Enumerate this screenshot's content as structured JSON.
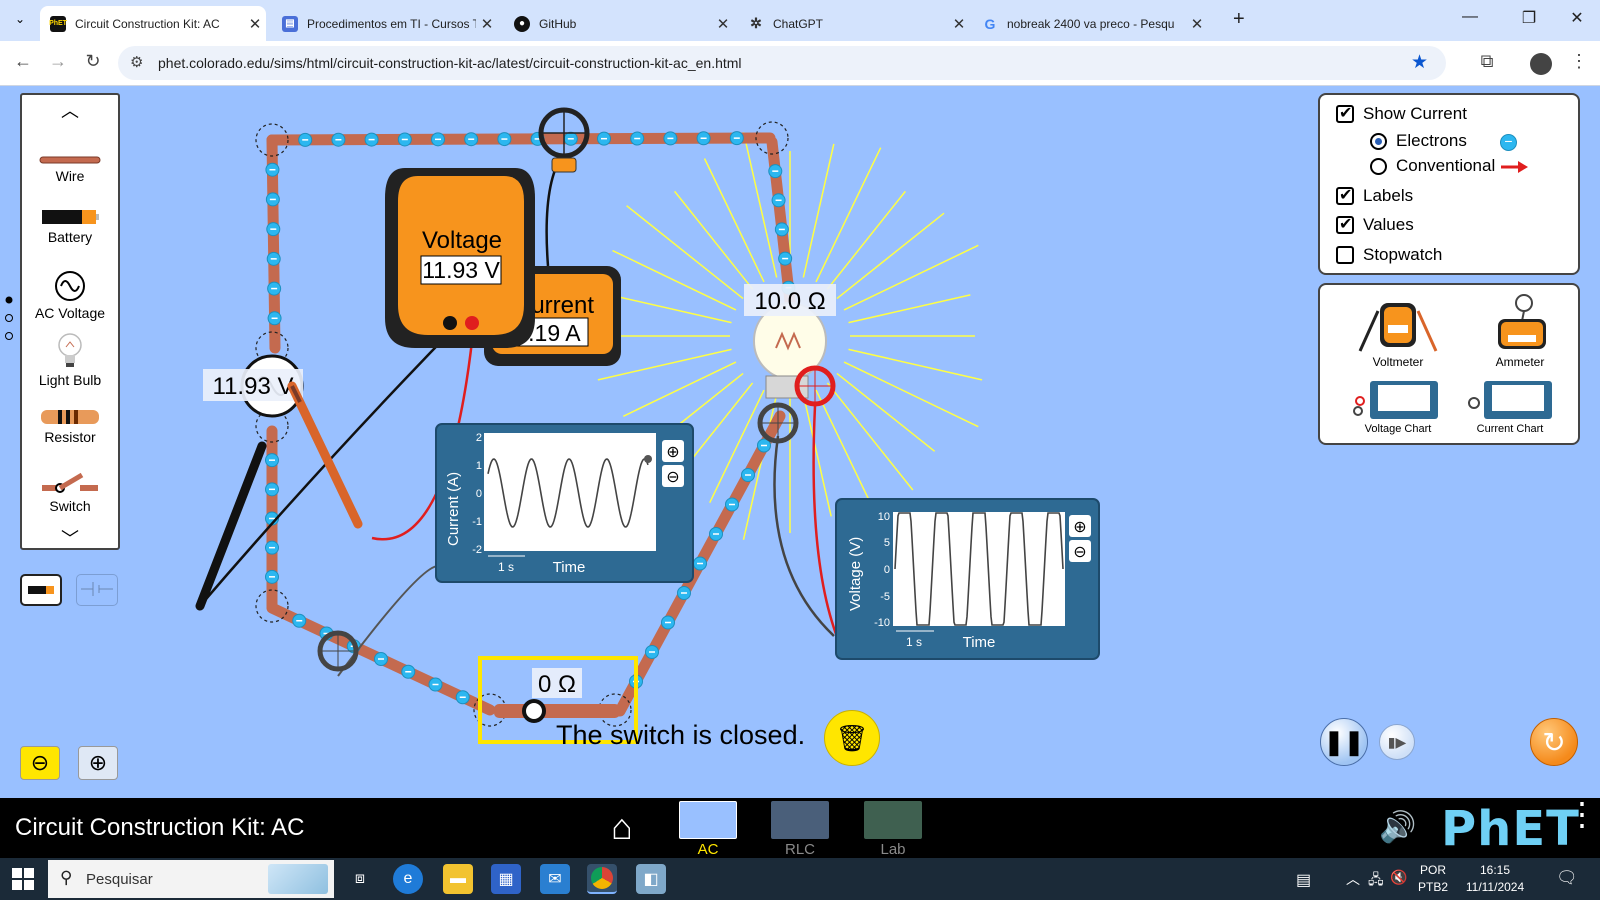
{
  "browser": {
    "tabs": [
      {
        "title": "Circuit Construction Kit: AC",
        "active": true,
        "icon": "phet-favicon"
      },
      {
        "title": "Procedimentos em TI - Cursos T",
        "active": false,
        "icon": "docs-favicon"
      },
      {
        "title": "GitHub",
        "active": false,
        "icon": "github-favicon"
      },
      {
        "title": "ChatGPT",
        "active": false,
        "icon": "chatgpt-favicon"
      },
      {
        "title": "nobreak 2400 va preco - Pesqu",
        "active": false,
        "icon": "google-favicon"
      }
    ],
    "url": "phet.colorado.edu/sims/html/circuit-construction-kit-ac/latest/circuit-construction-kit-ac_en.html"
  },
  "toolbox": {
    "items": [
      {
        "label": "Wire"
      },
      {
        "label": "Battery"
      },
      {
        "label": "AC Voltage"
      },
      {
        "label": "Light Bulb"
      },
      {
        "label": "Resistor"
      },
      {
        "label": "Switch"
      }
    ]
  },
  "display_options": {
    "show_current": {
      "label": "Show Current",
      "checked": true
    },
    "electrons": {
      "label": "Electrons",
      "selected": true
    },
    "conventional": {
      "label": "Conventional",
      "selected": false
    },
    "labels": {
      "label": "Labels",
      "checked": true
    },
    "values": {
      "label": "Values",
      "checked": true
    },
    "stopwatch": {
      "label": "Stopwatch",
      "checked": false
    }
  },
  "sensor_tools": {
    "voltmeter": "Voltmeter",
    "ammeter": "Ammeter",
    "voltage_chart": "Voltage Chart",
    "current_chart": "Current Chart"
  },
  "circuit": {
    "ac_source_label": "11.93 V",
    "bulb_label": "10.0 Ω",
    "switch_label": "0 Ω",
    "status": "The switch is closed."
  },
  "voltmeter": {
    "title": "Voltage",
    "value": "11.93 V"
  },
  "ammeter": {
    "title": "Current",
    "value": "1.19 A"
  },
  "current_chart": {
    "ylabel": "Current (A)",
    "xlabel": "Time",
    "scale": "1 s",
    "ticks": [
      "2",
      "1",
      "0",
      "-1",
      "-2"
    ]
  },
  "voltage_chart": {
    "ylabel": "Voltage (V)",
    "xlabel": "Time",
    "scale": "1 s",
    "ticks": [
      "10",
      "5",
      "0",
      "-5",
      "-10"
    ]
  },
  "navbar": {
    "title": "Circuit Construction Kit: AC",
    "screens": [
      {
        "label": "AC Voltage",
        "selected": true
      },
      {
        "label": "RLC",
        "selected": false
      },
      {
        "label": "Lab",
        "selected": false
      }
    ],
    "brand": "PhET"
  },
  "taskbar": {
    "search_placeholder": "Pesquisar",
    "lang": "POR",
    "layout": "PTB2",
    "time": "16:15",
    "date": "11/11/2024"
  },
  "colors": {
    "sim_bg": "#99c0ff",
    "meter_orange": "#f7941d",
    "chart_panel": "#2e6a93",
    "electron_blue": "#2cb7f0",
    "highlight_yellow": "#ffe600"
  }
}
